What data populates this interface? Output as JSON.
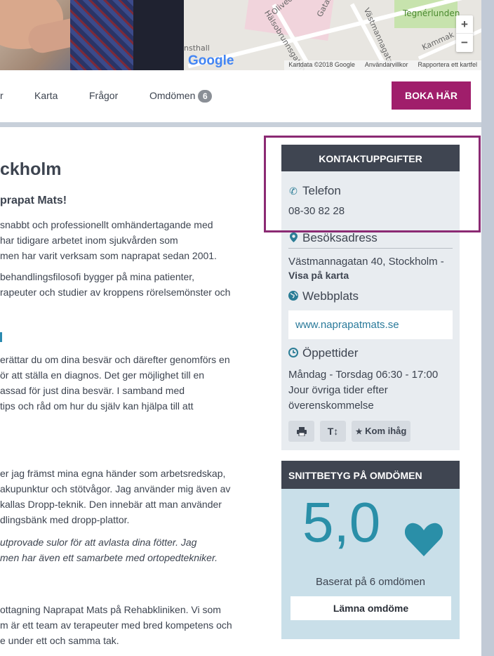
{
  "map": {
    "labels": {
      "tegnerlunden": "Tegnérlunden",
      "vastmannagatan": "Västmannagatan",
      "halsobrunnsgatan": "Hälsobrunnsgatan",
      "kammak": "Kammak",
      "olivecrona": "Olivecr",
      "gatan": "Gatan",
      "nsthall": "nsthall"
    },
    "logo": "Google",
    "attribution": [
      "Kartdata ©2018 Google",
      "Användarvillkor",
      "Rapportera ett kartfel"
    ],
    "zoom_in": "+",
    "zoom_out": "−"
  },
  "nav": {
    "items": [
      "r",
      "Karta",
      "Frågor",
      "Omdömen"
    ],
    "reviews_count": "6",
    "book_label": "BOKA HÄR"
  },
  "main": {
    "title": "ckholm",
    "subtitle": "prapat Mats!",
    "para1": [
      "snabbt och professionellt omhändertagande med",
      "har tidigare arbetet inom sjukvården som",
      "men har varit verksam som naprapat sedan 2001."
    ],
    "para2": [
      "behandlingsfilosofi bygger på mina patienter,",
      "rapeuter och studier av kroppens rörelsemönster och"
    ],
    "para3": [
      "erättar du om dina besvär och därefter genomförs en",
      "ör att ställa en diagnos. Det ger möjlighet till en",
      "assad för just dina besvär. I samband med",
      "tips och råd om hur du själv kan hjälpa till att"
    ],
    "para4": [
      "er jag främst mina egna händer som arbetsredskap,",
      "akupunktur och stötvågor. Jag använder mig även av",
      "kallas Dropp-teknik. Den innebär att man använder",
      "dlingsbänk med dropp-plattor."
    ],
    "para5": [
      "utprovade sulor för att avlasta dina fötter. Jag",
      "men har även ett samarbete med ortopedtekniker."
    ],
    "para6": [
      "ottagning Naprapat Mats på Rehabkliniken. Vi som",
      "m är ett team av terapeuter med bred kompetens och",
      "e under ett och samma tak."
    ]
  },
  "contact": {
    "heading": "KONTAKTUPPGIFTER",
    "phone_label": "Telefon",
    "phone": "08-30 82 28",
    "address_label": "Besöksadress",
    "address": "Västmannagatan 40, Stockholm -",
    "map_link": "Visa på karta",
    "web_label": "Webbplats",
    "web": "www.naprapatmats.se",
    "hours_label": "Öppettider",
    "hours": [
      "Måndag - Torsdag 06:30 - 17:00",
      "Jour övriga tider efter",
      "överenskommelse"
    ],
    "tools": {
      "remember": "Kom ihåg"
    }
  },
  "rating": {
    "heading": "SNITTBETYG PÅ OMDÖMEN",
    "score": "5,0",
    "based": "Baserat på 6 omdömen",
    "leave": "Lämna omdöme"
  },
  "colors": {
    "accent": "#a01e6b",
    "dark": "#3f4551",
    "teal": "#2a8fa8"
  }
}
